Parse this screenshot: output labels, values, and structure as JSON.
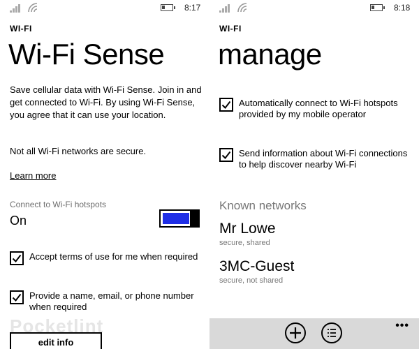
{
  "left": {
    "status": {
      "time": "8:17"
    },
    "app_title": "WI-FI",
    "page_title": "Wi-Fi Sense",
    "description": "Save cellular data with Wi-Fi Sense. Join in and get connected to Wi-Fi. By using Wi-Fi Sense, you agree that it can use your location.",
    "security_note": "Not all Wi-Fi networks are secure.",
    "learn_more": "Learn more",
    "connect_label": "Connect to Wi-Fi hotspots",
    "connect_state": "On",
    "toggle_on": true,
    "check_accept": "Accept terms of use for me when required",
    "check_provide": "Provide a name, email, or phone number when required",
    "edit_info": "edit info",
    "watermark": "Pocketlint"
  },
  "right": {
    "status": {
      "time": "8:18"
    },
    "app_title": "WI-FI",
    "page_title": "manage",
    "check_auto": "Automatically connect to Wi-Fi hotspots provided by my mobile operator",
    "check_send": "Send information about Wi-Fi connections to help discover nearby Wi-Fi",
    "known_networks": "Known networks",
    "networks": [
      {
        "name": "Mr Lowe",
        "detail": "secure, shared"
      },
      {
        "name": "3MC-Guest",
        "detail": "secure, not shared"
      }
    ],
    "app_bar": {
      "add_icon": "add-icon",
      "list_icon": "list-icon",
      "more": "•••"
    }
  },
  "colors": {
    "toggle_accent": "#1f2ee6",
    "app_bar": "#d9d9d9",
    "secondary_text": "#777777"
  }
}
